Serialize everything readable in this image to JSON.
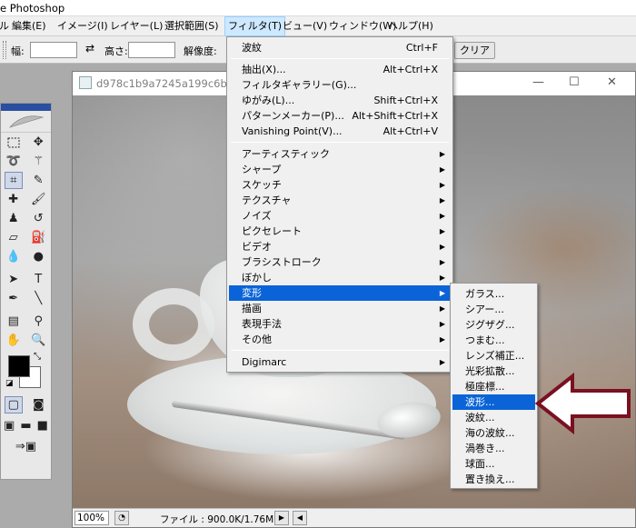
{
  "app": {
    "title": "e Photoshop"
  },
  "menubar": {
    "items": [
      "ル",
      "編集(E)",
      "イメージ(I)",
      "レイヤー(L)",
      "選択範囲(S)",
      "フィルタ(T)",
      "ビュー(V)",
      "ウィンドウ(W)",
      "ヘルプ(H)"
    ],
    "active": "フィルタ(T)"
  },
  "options": {
    "width_label": "幅:",
    "height_label": "高さ:",
    "resolution_label": "解像度:",
    "clear_button": "クリア",
    "width_value": "",
    "height_value": ""
  },
  "document": {
    "title": "d978c1b9a7245a199c6b7f2c9",
    "zoom": "100%",
    "file_info": "ファイル : 900.0K/1.76M",
    "controls": {
      "minimize": "—",
      "maximize": "☐",
      "close": "✕"
    }
  },
  "filter_menu": {
    "items": [
      {
        "label": "波紋",
        "shortcut": "Ctrl+F"
      },
      {
        "label": "抽出(X)...",
        "shortcut": "Alt+Ctrl+X"
      },
      {
        "label": "フィルタギャラリー(G)...",
        "shortcut": ""
      },
      {
        "label": "ゆがみ(L)...",
        "shortcut": "Shift+Ctrl+X"
      },
      {
        "label": "パターンメーカー(P)...",
        "shortcut": "Alt+Shift+Ctrl+X"
      },
      {
        "label": "Vanishing Point(V)...",
        "shortcut": "Alt+Ctrl+V"
      },
      {
        "label": "アーティスティック",
        "shortcut": ""
      },
      {
        "label": "シャープ",
        "shortcut": ""
      },
      {
        "label": "スケッチ",
        "shortcut": ""
      },
      {
        "label": "テクスチャ",
        "shortcut": ""
      },
      {
        "label": "ノイズ",
        "shortcut": ""
      },
      {
        "label": "ピクセレート",
        "shortcut": ""
      },
      {
        "label": "ビデオ",
        "shortcut": ""
      },
      {
        "label": "ブラシストローク",
        "shortcut": ""
      },
      {
        "label": "ぼかし",
        "shortcut": ""
      },
      {
        "label": "変形",
        "shortcut": ""
      },
      {
        "label": "描画",
        "shortcut": ""
      },
      {
        "label": "表現手法",
        "shortcut": ""
      },
      {
        "label": "その他",
        "shortcut": ""
      },
      {
        "label": "Digimarc",
        "shortcut": ""
      }
    ],
    "highlighted": "変形"
  },
  "distort_submenu": {
    "items": [
      "ガラス...",
      "シアー...",
      "ジグザグ...",
      "つまむ...",
      "レンズ補正...",
      "光彩拡散...",
      "極座標...",
      "波形...",
      "波紋...",
      "海の波紋...",
      "渦巻き...",
      "球面...",
      "置き換え..."
    ],
    "highlighted": "波形..."
  },
  "colors": {
    "highlight": "#0a64d8",
    "pointer_arrow": "#7a1020",
    "foreground": "#000000",
    "background": "#ffffff"
  },
  "icons": [
    "marquee-icon",
    "move-icon",
    "lasso-icon",
    "magic-wand-icon",
    "crop-icon",
    "slice-icon",
    "healing-brush-icon",
    "brush-icon",
    "clone-stamp-icon",
    "history-brush-icon",
    "eraser-icon",
    "paint-bucket-icon",
    "blur-icon",
    "dodge-icon",
    "path-selection-icon",
    "type-icon",
    "pen-icon",
    "line-icon",
    "notes-icon",
    "eyedropper-icon",
    "hand-icon",
    "zoom-icon"
  ]
}
